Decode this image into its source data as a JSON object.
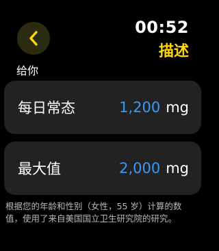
{
  "header": {
    "back_icon": "chevron-left-icon",
    "time": "00:52",
    "title": "描述"
  },
  "section": {
    "label": "给你"
  },
  "cards": [
    {
      "label": "每日常态",
      "value": "1,200",
      "unit": "mg"
    },
    {
      "label": "最大值",
      "value": "2,000",
      "unit": "mg"
    }
  ],
  "footnote": "根据您的年龄和性别（女性，55 岁）计算的数值，使用了来自美国国立卫生研究院的研究。",
  "colors": {
    "accent": "#ffd60a",
    "value": "#3a9bf5",
    "card": "#222222",
    "background": "#000000"
  }
}
